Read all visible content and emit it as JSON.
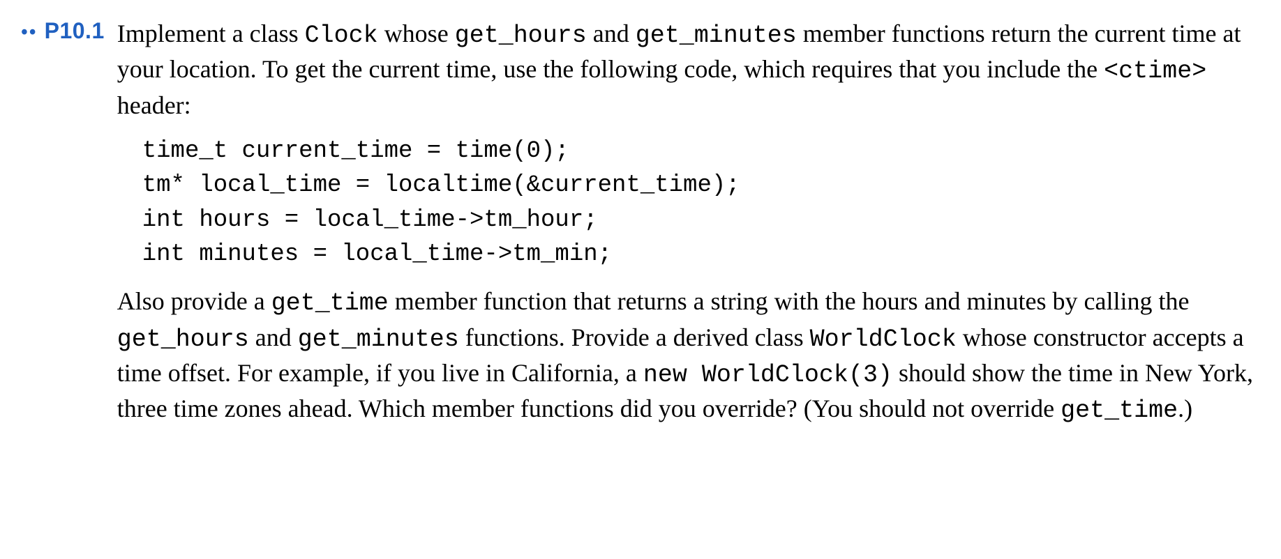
{
  "problem": {
    "bullets": "••",
    "number": "P10.1",
    "para1_parts": [
      {
        "t": "Implement a class "
      },
      {
        "t": "Clock",
        "code": true
      },
      {
        "t": " whose "
      },
      {
        "t": "get_hours",
        "code": true
      },
      {
        "t": " and "
      },
      {
        "t": "get_minutes",
        "code": true
      },
      {
        "t": " member functions return the current time at your location. To get the current time, use the following code, which requires that you include the "
      },
      {
        "t": "<ctime>",
        "code": true
      },
      {
        "t": " header:"
      }
    ],
    "code_lines": [
      "time_t current_time = time(0);",
      "tm* local_time = localtime(&current_time);",
      "int hours = local_time->tm_hour;",
      "int minutes = local_time->tm_min;"
    ],
    "para2_parts": [
      {
        "t": "Also provide a "
      },
      {
        "t": "get_time",
        "code": true
      },
      {
        "t": " member function that returns a string with the hours and minutes by calling the "
      },
      {
        "t": "get_hours",
        "code": true
      },
      {
        "t": " and "
      },
      {
        "t": "get_minutes",
        "code": true
      },
      {
        "t": " functions. Provide a derived class "
      },
      {
        "t": "WorldClock",
        "code": true
      },
      {
        "t": " whose constructor accepts a time offset. For example, if you live in California, a "
      },
      {
        "t": "new WorldClock(3)",
        "code": true
      },
      {
        "t": " should show the time in New York, three time zones ahead. Which member functions did you override? (You should not override "
      },
      {
        "t": "get_time",
        "code": true
      },
      {
        "t": ".)"
      }
    ]
  }
}
